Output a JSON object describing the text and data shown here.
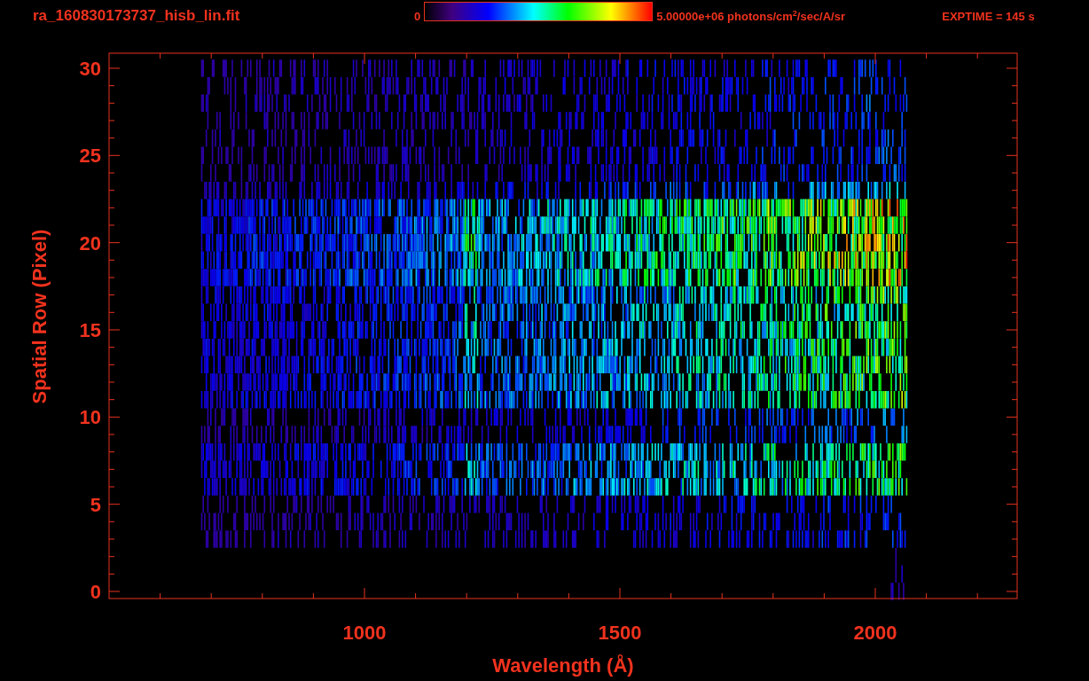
{
  "header": {
    "title": "ra_160830173737_hisb_lin.fit",
    "colorbar_min": "0",
    "colorbar_max": "5.00000e+06 photons/cm$^{2}$/sec/A/sr",
    "exposure": "EXPTIME = 145 s"
  },
  "plot": {
    "x_axis": {
      "title": "Wavelength (Å)",
      "tick_labels": [
        "1000",
        "1500",
        "2000"
      ]
    },
    "y_axis": {
      "title": "Spatial Row (Pixel)",
      "tick_labels": [
        "30",
        "25",
        "20",
        "15",
        "10",
        "5",
        "0"
      ]
    }
  }
}
